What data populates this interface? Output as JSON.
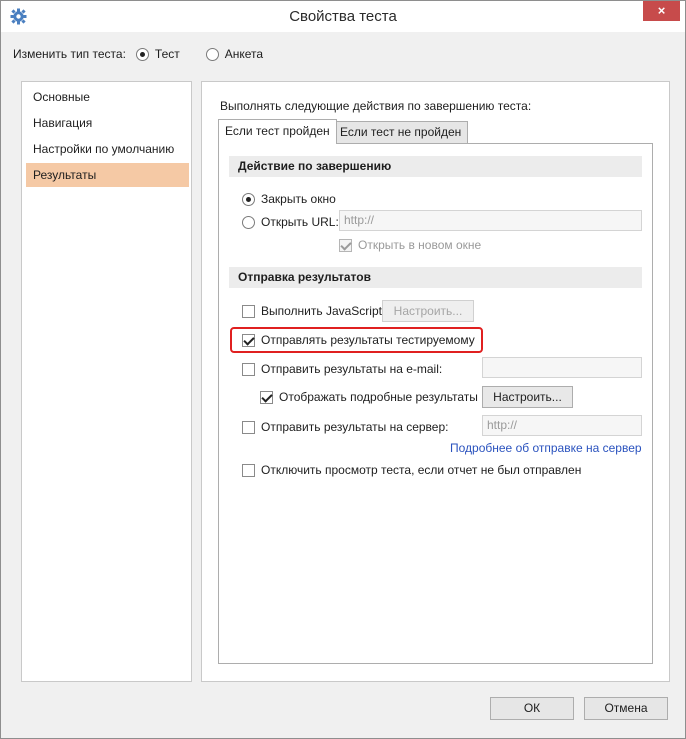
{
  "window": {
    "title": "Свойства теста",
    "close_label": "×"
  },
  "test_type": {
    "label": "Изменить тип теста:",
    "options": [
      {
        "label": "Тест",
        "selected": true
      },
      {
        "label": "Анкета",
        "selected": false
      }
    ]
  },
  "sidebar": {
    "items": [
      {
        "label": "Основные",
        "selected": false
      },
      {
        "label": "Навигация",
        "selected": false
      },
      {
        "label": "Настройки по умолчанию",
        "selected": false
      },
      {
        "label": "Результаты",
        "selected": true
      }
    ],
    "selected_color": "#f5c9a5"
  },
  "main": {
    "caption": "Выполнять следующие действия по завершению теста:",
    "tabs": [
      {
        "label": "Если тест пройден",
        "active": true
      },
      {
        "label": "Если тест не пройден",
        "active": false
      }
    ],
    "completion": {
      "header": "Действие по завершению",
      "close_window": "Закрыть окно",
      "open_url": "Открыть URL:",
      "url_placeholder": "http://",
      "new_window": "Открыть в новом окне"
    },
    "results": {
      "header": "Отправка результатов",
      "run_js": "Выполнить JavaScript",
      "configure": "Настроить...",
      "send_to_testee": "Отправлять результаты тестируемому",
      "send_email": "Отправить результаты на e-mail:",
      "show_detailed": "Отображать подробные результаты",
      "configure2": "Настроить...",
      "send_server": "Отправить результаты на сервер:",
      "server_placeholder": "http://",
      "server_link": "Подробнее об отправке на сервер",
      "disable_view": "Отключить просмотр теста, если отчет не был отправлен"
    }
  },
  "footer": {
    "ok": "ОК",
    "cancel": "Отмена"
  },
  "colors": {
    "highlight": "#e02020",
    "link": "#2a52be",
    "close": "#c74b4b"
  }
}
